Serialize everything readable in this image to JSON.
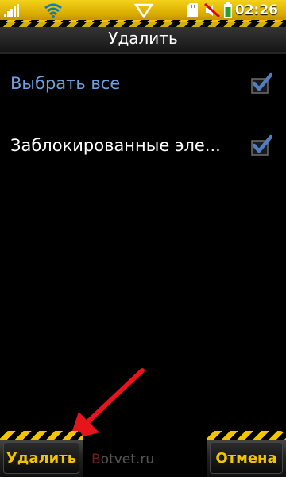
{
  "status_bar": {
    "time": "02:26"
  },
  "title_bar": {
    "title": "Удалить"
  },
  "list": {
    "items": [
      {
        "label": "Выбрать все",
        "checked": true
      },
      {
        "label": "Заблокированные эле...",
        "checked": true
      }
    ]
  },
  "softkeys": {
    "left_label": "Удалить",
    "right_label": "Отмена"
  },
  "watermark": {
    "first": "B",
    "rest": "otvet.ru"
  },
  "colors": {
    "accent": "#6e9fdf",
    "softkey_text": "#f2c400",
    "annotation_arrow": "#e8141c"
  },
  "icons": [
    "signal-strength-icon",
    "wifi-icon",
    "notification-triangle-icon",
    "sd-card-icon",
    "muted-icon",
    "battery-icon",
    "checkbox-checked-icon",
    "red-arrow-annotation"
  ]
}
